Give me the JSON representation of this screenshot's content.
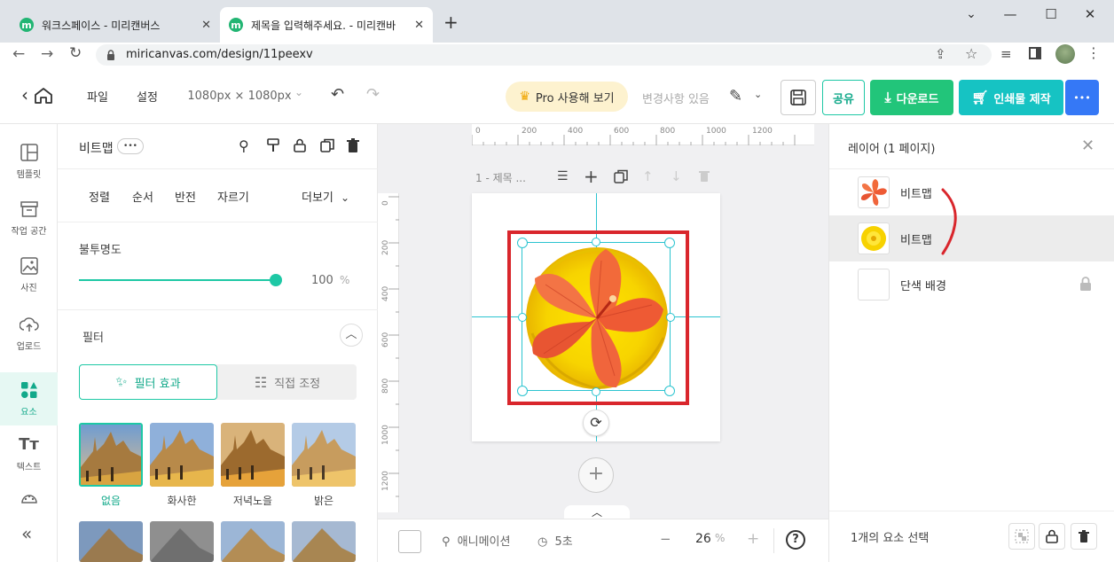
{
  "browser": {
    "tabs": [
      {
        "label": "워크스페이스 - 미리캔버스",
        "active": false
      },
      {
        "label": "제목을 입력해주세요. - 미리캔바",
        "active": true
      }
    ],
    "new_tab": "+",
    "url": "miricanvas.com/design/11peexv",
    "window_controls": {
      "minimize": "—",
      "maximize": "☐",
      "close": "✕",
      "dropdown": "⌄"
    }
  },
  "appbar": {
    "file_menu": "파일",
    "settings_menu": "설정",
    "size_label": "1080px × 1080px",
    "pro_button": "Pro 사용해 보기",
    "changes_status": "변경사항 있음",
    "share_button": "공유",
    "download_button": "다운로드",
    "print_button": "인쇄물 제작",
    "more_button": "•••"
  },
  "leftnav": {
    "items": [
      {
        "label": "템플릿",
        "icon": "template-icon"
      },
      {
        "label": "작업 공간",
        "icon": "workspace-icon"
      },
      {
        "label": "사진",
        "icon": "photo-icon"
      },
      {
        "label": "업로드",
        "icon": "upload-icon"
      },
      {
        "label": "요소",
        "icon": "elements-icon",
        "active": true
      },
      {
        "label": "텍스트",
        "icon": "text-icon"
      },
      {
        "label": "",
        "icon": "palette-icon"
      }
    ],
    "collapse": "«"
  },
  "panel": {
    "title": "비트맵",
    "more_pill": "•••",
    "tabs": [
      "정렬",
      "순서",
      "반전",
      "자르기"
    ],
    "more": "더보기",
    "opacity_label": "불투명도",
    "opacity_value": "100",
    "opacity_unit": "%",
    "opacity_level": 1.0,
    "filter_label": "필터",
    "filter_tab_effect": "필터 효과",
    "filter_tab_adjust": "직접 조정",
    "filters": [
      {
        "label": "없음",
        "selected": true
      },
      {
        "label": "화사한",
        "selected": false
      },
      {
        "label": "저녁노을",
        "selected": false
      },
      {
        "label": "밝은",
        "selected": false
      }
    ]
  },
  "canvas": {
    "page_label": "1 - 제목 ...",
    "ruler_h": [
      "0",
      "200",
      "400",
      "600",
      "800",
      "1000",
      "1200"
    ],
    "ruler_v": [
      "0",
      "200",
      "400",
      "600",
      "800",
      "1000",
      "1200"
    ],
    "add_page": "+",
    "bottom": {
      "animation": "애니메이션",
      "duration": "5초",
      "zoom_value": "26",
      "zoom_unit": "%",
      "minus": "−",
      "plus": "+",
      "help": "?"
    }
  },
  "layers": {
    "title": "레이어 (1 페이지)",
    "items": [
      {
        "label": "비트맵",
        "thumb": "hibiscus",
        "selected": false
      },
      {
        "label": "비트맵",
        "thumb": "yellow-flower",
        "selected": true
      },
      {
        "label": "단색 배경",
        "thumb": "blank",
        "selected": false,
        "locked": true
      }
    ],
    "selection_status": "1개의 요소 선택"
  },
  "colors": {
    "accent_green": "#1ec8a5",
    "download_green": "#22c57a",
    "print_teal": "#16c3c3",
    "more_blue": "#3578f6",
    "selection_cyan": "#2bc4d0",
    "annotation_red": "#d9262c"
  }
}
